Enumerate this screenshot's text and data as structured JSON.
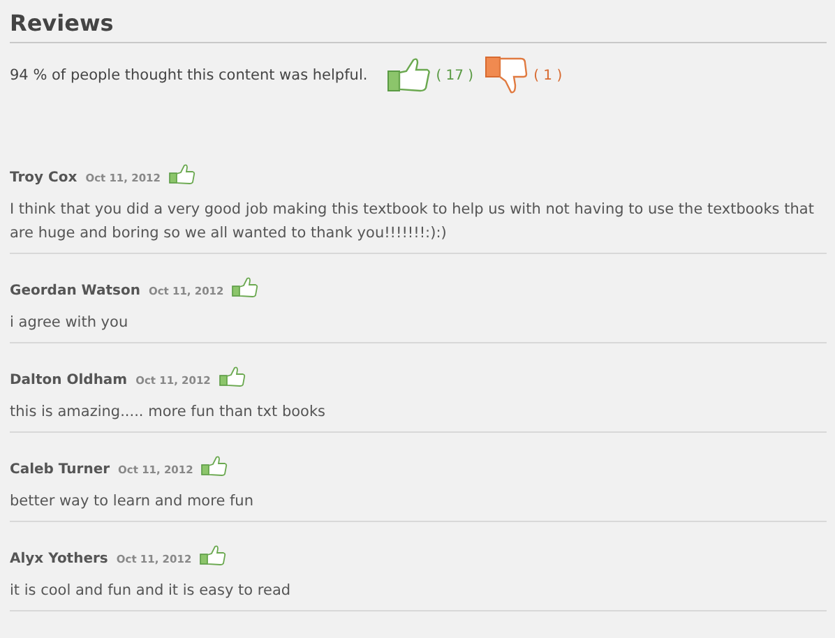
{
  "title": "Reviews",
  "summary": {
    "text": "94 % of people thought this content was helpful.",
    "up_count": "( 17 )",
    "down_count": "( 1 )"
  },
  "reviews": [
    {
      "name": "Troy Cox",
      "date": "Oct 11, 2012",
      "kind": "liked",
      "text": "I think that you did a very good job making this textbook to help us with not having to use the textbooks that are huge and boring so we all wanted to thank you!!!!!!!:):)"
    },
    {
      "name": "Geordan Watson",
      "date": "Oct 11, 2012",
      "kind": "liked",
      "text": "i agree with you"
    },
    {
      "name": "Dalton Oldham",
      "date": "Oct 11, 2012",
      "kind": "liked",
      "text": "this is amazing..... more fun than txt books"
    },
    {
      "name": "Caleb Turner",
      "date": "Oct 11, 2012",
      "kind": "liked",
      "text": "better way to learn and more fun"
    },
    {
      "name": "Alyx Yothers",
      "date": "Oct 11, 2012",
      "kind": "liked",
      "text": "it is cool and fun and it is easy to read"
    }
  ]
}
